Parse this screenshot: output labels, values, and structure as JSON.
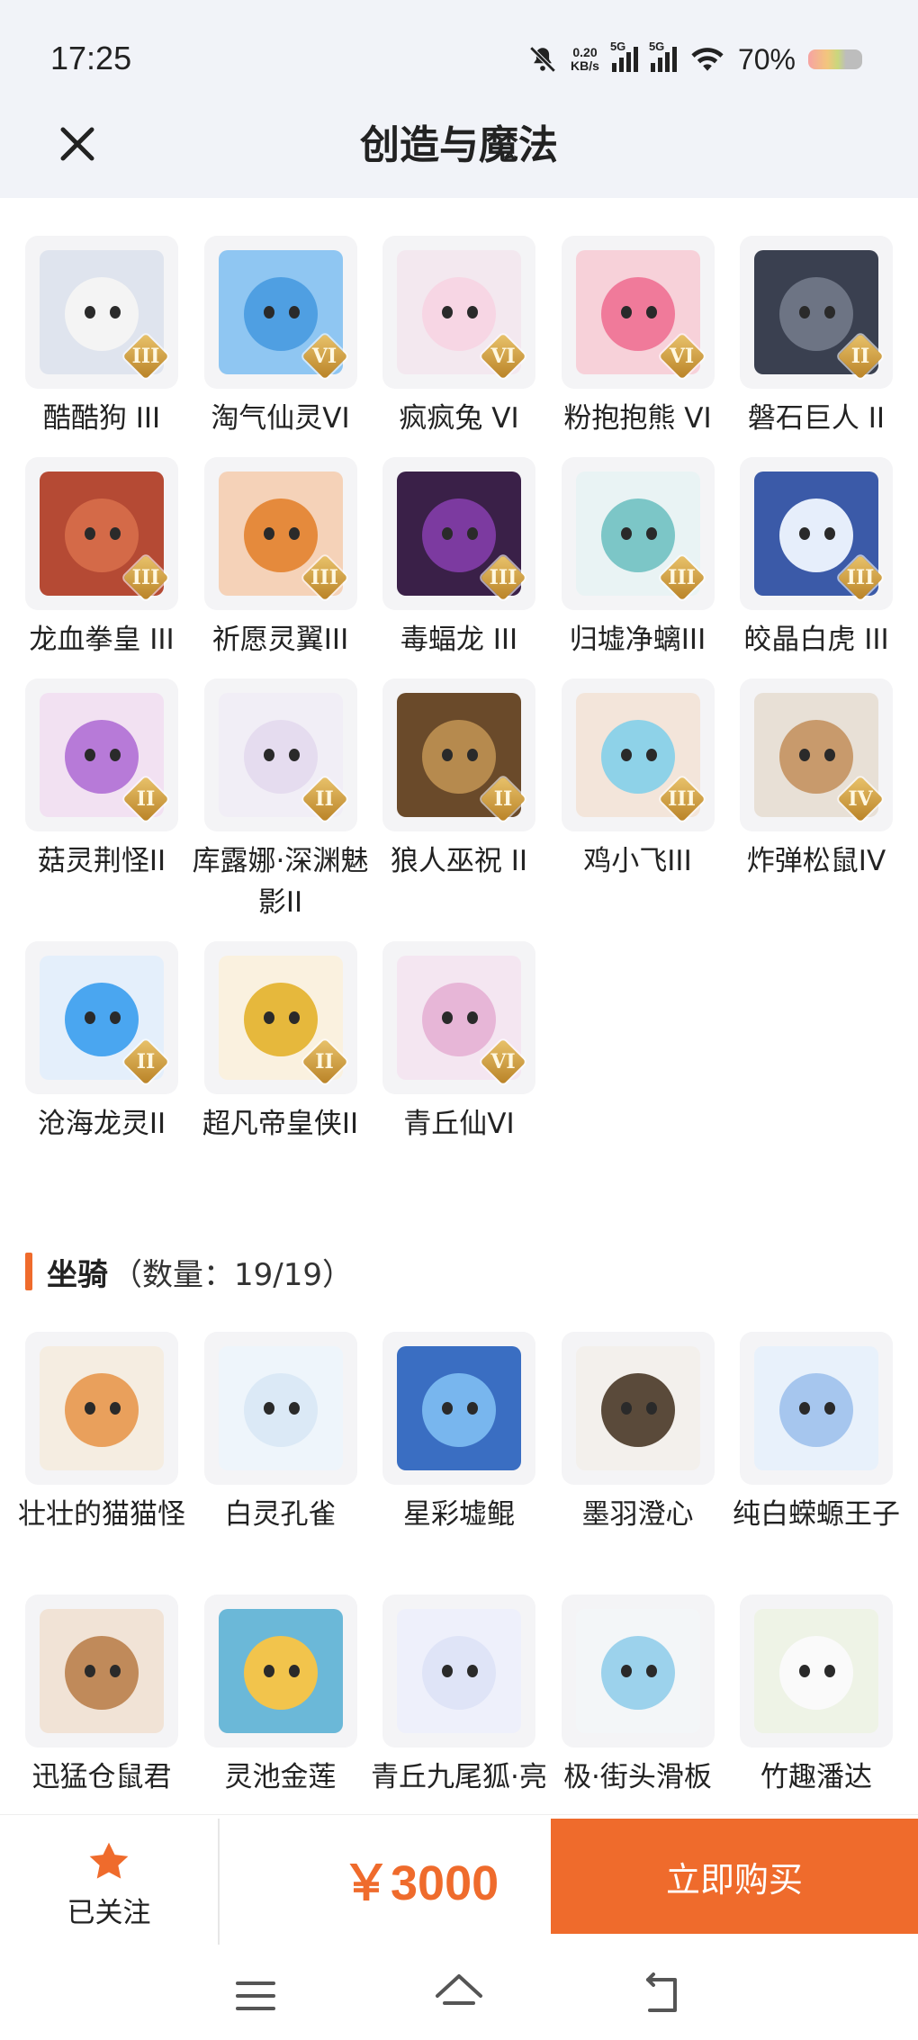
{
  "status_bar": {
    "time": "17:25",
    "net_speed_value": "0.20",
    "net_speed_unit": "KB/s",
    "signal_1_label": "5G",
    "signal_2_label": "5G",
    "battery_percent": "70%"
  },
  "header": {
    "title": "创造与魔法"
  },
  "pets": {
    "items": [
      {
        "name": "酷酷狗 III",
        "rank": "III",
        "bg": "#dfe4ee",
        "face": "#f4f4f4",
        "icon": "cool-dog-icon"
      },
      {
        "name": "淘气仙灵VI",
        "rank": "VI",
        "bg": "#8fc6f2",
        "face": "#4f9fe2",
        "icon": "naughty-fairy-icon"
      },
      {
        "name": "疯疯兔 VI",
        "rank": "VI",
        "bg": "#f3e8ef",
        "face": "#f7d6e4",
        "icon": "crazy-rabbit-icon"
      },
      {
        "name": "粉抱抱熊 VI",
        "rank": "VI",
        "bg": "#f7d1d9",
        "face": "#f07a9a",
        "icon": "pink-bear-icon"
      },
      {
        "name": "磐石巨人 II",
        "rank": "II",
        "bg": "#3a4050",
        "face": "#6d7484",
        "icon": "rock-giant-icon"
      },
      {
        "name": "龙血拳皇 III",
        "rank": "III",
        "bg": "#b54a34",
        "face": "#d46a48",
        "icon": "dragon-boxer-icon"
      },
      {
        "name": "祈愿灵翼III",
        "rank": "III",
        "bg": "#f5d2b8",
        "face": "#e58a3c",
        "icon": "wish-wing-icon"
      },
      {
        "name": "毒蝠龙 III",
        "rank": "III",
        "bg": "#3a2048",
        "face": "#7c3aa0",
        "icon": "poison-bat-dragon-icon"
      },
      {
        "name": "归墟净螭III",
        "rank": "III",
        "bg": "#e9f3f4",
        "face": "#7cc6c7",
        "icon": "pure-chi-dragon-icon"
      },
      {
        "name": "皎晶白虎 III",
        "rank": "III",
        "bg": "#3b5aa8",
        "face": "#e6eefb",
        "icon": "white-tiger-icon"
      },
      {
        "name": "菇灵荆怪II",
        "rank": "II",
        "bg": "#f2e1f2",
        "face": "#b77ad8",
        "icon": "mushroom-spirit-icon"
      },
      {
        "name": "库露娜·深渊魅影II",
        "rank": "II",
        "bg": "#f1eef6",
        "face": "#e5dcef",
        "icon": "kuluna-icon"
      },
      {
        "name": "狼人巫祝 II",
        "rank": "II",
        "bg": "#6a4a2a",
        "face": "#b68a4e",
        "icon": "werewolf-shaman-icon"
      },
      {
        "name": "鸡小飞III",
        "rank": "III",
        "bg": "#f3e5da",
        "face": "#8ed2e8",
        "icon": "chicken-icon"
      },
      {
        "name": "炸弹松鼠IV",
        "rank": "IV",
        "bg": "#e8e0d6",
        "face": "#c89a6c",
        "icon": "bomb-squirrel-icon"
      },
      {
        "name": "沧海龙灵II",
        "rank": "II",
        "bg": "#e4effb",
        "face": "#4aa6f0",
        "icon": "sea-dragon-icon"
      },
      {
        "name": "超凡帝皇侠II",
        "rank": "II",
        "bg": "#faf1df",
        "face": "#e6b83c",
        "icon": "emperor-hero-icon"
      },
      {
        "name": "青丘仙VI",
        "rank": "VI",
        "bg": "#f4e6f1",
        "face": "#e7b6d7",
        "icon": "qingqiu-fairy-icon"
      }
    ]
  },
  "mounts": {
    "title": "坐骑",
    "count_text": "（数量：19/19）",
    "items": [
      {
        "name": "壮壮的猫猫怪",
        "bg": "#f5ede1",
        "face": "#e9a05c",
        "icon": "cat-monster-icon"
      },
      {
        "name": "白灵孔雀",
        "bg": "#eef5fb",
        "face": "#dbe9f6",
        "icon": "white-peacock-icon"
      },
      {
        "name": "星彩墟鲲",
        "bg": "#3a6ec2",
        "face": "#78b6ee",
        "icon": "star-kun-icon"
      },
      {
        "name": "墨羽澄心",
        "bg": "#f3f0ec",
        "face": "#5a4a3a",
        "icon": "ink-feather-icon"
      },
      {
        "name": "纯白蝾螈王子",
        "bg": "#e8f1fb",
        "face": "#a6c6ee",
        "icon": "axolotl-prince-icon"
      },
      {
        "name": "迅猛仓鼠君",
        "bg": "#f1e3d6",
        "face": "#c08a5a",
        "icon": "hamster-icon"
      },
      {
        "name": "灵池金莲",
        "bg": "#6bb8d8",
        "face": "#f2c44c",
        "icon": "golden-lotus-icon"
      },
      {
        "name": "青丘九尾狐·亮",
        "bg": "#eef0fb",
        "face": "#dfe4f7",
        "icon": "nine-tail-fox-icon"
      },
      {
        "name": "极·街头滑板",
        "bg": "#f3f6f8",
        "face": "#9cd2ec",
        "icon": "skateboard-icon"
      },
      {
        "name": "竹趣潘达",
        "bg": "#eef3e6",
        "face": "#fafafa",
        "icon": "panda-icon"
      }
    ]
  },
  "action_bar": {
    "follow_label": "已关注",
    "price": "￥3000",
    "buy_label": "立即购买",
    "accent_color": "#ef6b2c"
  }
}
